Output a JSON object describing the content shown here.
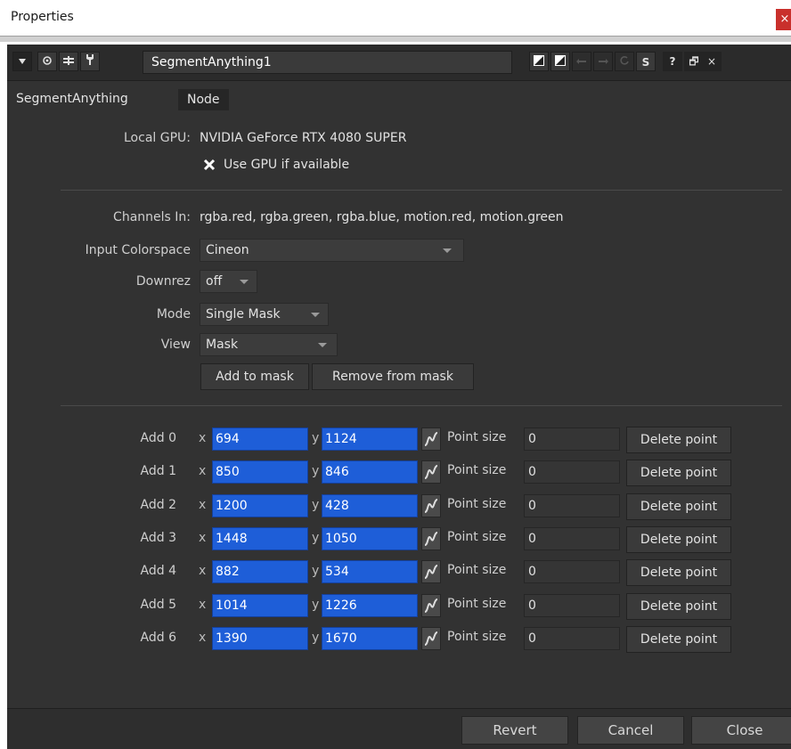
{
  "window": {
    "title": "Properties",
    "close_glyph": "×"
  },
  "toolbar": {
    "node_name": "SegmentAnything1",
    "help_glyph": "?",
    "float_glyph": "🗗",
    "close_glyph": "×",
    "s_label": "S"
  },
  "tabs": [
    {
      "label": "SegmentAnything",
      "active": true
    },
    {
      "label": "Node",
      "active": false
    }
  ],
  "gpu": {
    "label": "Local GPU:",
    "value": "NVIDIA GeForce RTX 4080 SUPER",
    "use_gpu_label": "Use GPU if available",
    "use_gpu_checked": true
  },
  "params": {
    "channels_label": "Channels In:",
    "channels_value": "rgba.red, rgba.green, rgba.blue, motion.red, motion.green",
    "colorspace_label": "Input Colorspace",
    "colorspace_value": "Cineon",
    "downrez_label": "Downrez",
    "downrez_value": "off",
    "mode_label": "Mode",
    "mode_value": "Single Mask",
    "view_label": "View",
    "view_value": "Mask",
    "add_to_mask": "Add to mask",
    "remove_from_mask": "Remove from mask"
  },
  "points": [
    {
      "label": "Add 0",
      "x": "694",
      "y": "1124",
      "size": "0"
    },
    {
      "label": "Add 1",
      "x": "850",
      "y": "846",
      "size": "0"
    },
    {
      "label": "Add 2",
      "x": "1200",
      "y": "428",
      "size": "0"
    },
    {
      "label": "Add 3",
      "x": "1448",
      "y": "1050",
      "size": "0"
    },
    {
      "label": "Add 4",
      "x": "882",
      "y": "534",
      "size": "0"
    },
    {
      "label": "Add 5",
      "x": "1014",
      "y": "1226",
      "size": "0"
    },
    {
      "label": "Add 6",
      "x": "1390",
      "y": "1670",
      "size": "0"
    }
  ],
  "point_labels": {
    "x": "x",
    "y": "y",
    "point_size": "Point size",
    "delete": "Delete point"
  },
  "footer": {
    "revert": "Revert",
    "cancel": "Cancel",
    "close": "Close"
  },
  "colors": {
    "panel_bg": "#323232",
    "field_blue": "#1e5ed8",
    "close_red": "#c9302c"
  }
}
